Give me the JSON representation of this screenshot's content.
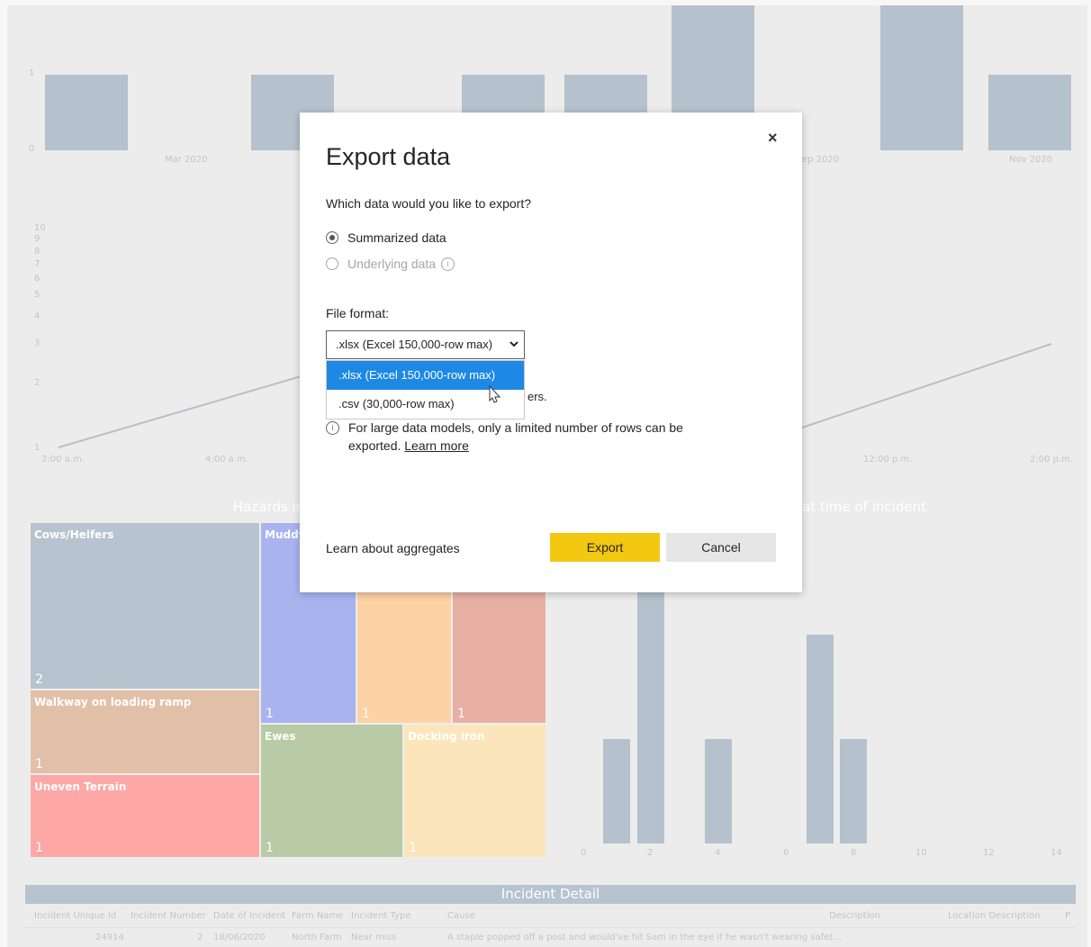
{
  "background": {
    "top_chart": {
      "y_ticks": [
        "1",
        "0"
      ],
      "x_ticks": [
        "Mar 2020",
        "ep 2020",
        "Nov 2020"
      ]
    },
    "line_chart": {
      "y_ticks": [
        "10",
        "9",
        "8",
        "7",
        "6",
        "5",
        "4",
        "3",
        "2",
        "1"
      ],
      "x_ticks": [
        "2:00 a.m.",
        "4:00 a.m.",
        "12:00 p.m.",
        "2:00 p.m."
      ]
    },
    "treemap": {
      "title_fragment": "Hazards in",
      "cells": [
        {
          "label": "Cows/Heifers",
          "count": "2"
        },
        {
          "label": "Muddy",
          "count": "1"
        },
        {
          "label": "",
          "count": "1"
        },
        {
          "label": "",
          "count": "1"
        },
        {
          "label": "Walkway on loading ramp",
          "count": "1"
        },
        {
          "label": "Ewes",
          "count": "1"
        },
        {
          "label": "Docking iron",
          "count": "1"
        },
        {
          "label": "Uneven Terrain",
          "count": "1"
        }
      ]
    },
    "histogram": {
      "title_fragment": "at time of incident",
      "x_ticks": [
        "0",
        "2",
        "4",
        "6",
        "8",
        "10",
        "12",
        "14"
      ]
    },
    "incident_detail": {
      "title": "Incident Detail",
      "columns": [
        "Incident Unique Id",
        "Incident Number",
        "Date of Incident",
        "Farm Name",
        "Incident Type",
        "Cause",
        "Description",
        "Location Description",
        "P"
      ],
      "row": [
        "24914",
        "2",
        "18/06/2020",
        "North Farm",
        "Near miss",
        "A staple popped off a post and would've hit Sam in the eye if he wasn't wearing safet..."
      ]
    }
  },
  "dialog": {
    "title": "Export data",
    "close_glyph": "×",
    "question": "Which data would you like to export?",
    "options": [
      {
        "label": "Summarized data",
        "selected": true,
        "enabled": true
      },
      {
        "label": "Underlying data",
        "selected": false,
        "enabled": false
      }
    ],
    "info_glyph": "i",
    "file_format_label": "File format:",
    "select_value": ".xlsx (Excel 150,000-row max)",
    "dropdown_options": [
      ".xlsx (Excel 150,000-row max)",
      ".csv (30,000-row max)"
    ],
    "hidden_fragment": "ers.",
    "note_text": "For large data models, only a limited number of rows can be exported.",
    "note_link": "Learn more",
    "learn_aggregates": "Learn about aggregates",
    "export_label": "Export",
    "cancel_label": "Cancel"
  },
  "colors": {
    "bar": "#b5c1cd",
    "export_button": "#f2c811",
    "selected_option": "#1e88e5",
    "treemap": [
      "#b7c3ce",
      "#a9b4ef",
      "#fdd2a4",
      "#e8b0a5",
      "#e2c0a8",
      "#b9cba6",
      "#fbe6bb",
      "#fda8a7"
    ]
  }
}
